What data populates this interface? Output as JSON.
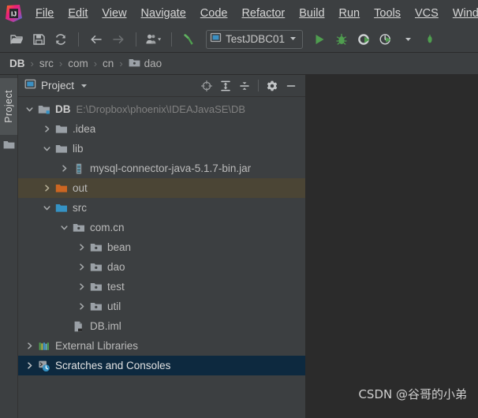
{
  "app": {
    "logo_icon": "intellij-idea-logo",
    "watermark": "CSDN @谷哥的小弟"
  },
  "menubar": {
    "items": [
      {
        "label": "File",
        "mnemonic": "F"
      },
      {
        "label": "Edit",
        "mnemonic": "E"
      },
      {
        "label": "View",
        "mnemonic": "V"
      },
      {
        "label": "Navigate",
        "mnemonic": "N"
      },
      {
        "label": "Code",
        "mnemonic": "C"
      },
      {
        "label": "Refactor",
        "mnemonic": "R"
      },
      {
        "label": "Build",
        "mnemonic": "B"
      },
      {
        "label": "Run",
        "mnemonic": "u"
      },
      {
        "label": "Tools",
        "mnemonic": "T"
      },
      {
        "label": "VCS",
        "mnemonic": "S"
      },
      {
        "label": "Window",
        "mnemonic": "W"
      }
    ]
  },
  "toolbar": {
    "buttons": [
      {
        "name": "open-project-icon",
        "title": "Open"
      },
      {
        "name": "save-all-icon",
        "title": "Save All"
      },
      {
        "name": "sync-refresh-icon",
        "title": "Synchronize"
      },
      {
        "name": "back-arrow-icon",
        "title": "Back"
      },
      {
        "name": "forward-arrow-icon",
        "title": "Forward"
      },
      {
        "name": "vcs-user-icon",
        "title": "User"
      },
      {
        "name": "build-hammer-icon",
        "title": "Build Project"
      }
    ],
    "run_config": {
      "label": "TestJDBC01",
      "icon": "run-config-icon",
      "dropdown_icon": "chevron-down-icon"
    },
    "run_buttons": [
      {
        "name": "run-icon",
        "title": "Run",
        "color": "#3f9c41"
      },
      {
        "name": "debug-icon",
        "title": "Debug",
        "color": "#3f9c41"
      },
      {
        "name": "coverage-icon",
        "title": "Run with Coverage",
        "color": "#3f9c41"
      },
      {
        "name": "profiler-icon",
        "title": "Profile",
        "color": "#3f9c41"
      }
    ]
  },
  "breadcrumb": {
    "separator": "›",
    "items": [
      {
        "label": "DB",
        "bold": true,
        "icon": null
      },
      {
        "label": "src",
        "bold": false,
        "icon": null
      },
      {
        "label": "com",
        "bold": false,
        "icon": null
      },
      {
        "label": "cn",
        "bold": false,
        "icon": null
      },
      {
        "label": "dao",
        "bold": false,
        "icon": "package-folder-icon"
      }
    ]
  },
  "left_strip": {
    "tab_label": "Project",
    "tab_icon": "project-folder-icon"
  },
  "project_panel": {
    "title": "Project",
    "title_icon": "project-view-icon",
    "dropdown_icon": "chevron-down-icon",
    "actions": [
      {
        "name": "locate-target-icon",
        "title": "Select Opened File"
      },
      {
        "name": "expand-all-icon",
        "title": "Expand All"
      },
      {
        "name": "collapse-all-icon",
        "title": "Collapse All"
      },
      {
        "name": "settings-gear-icon",
        "title": "Options"
      },
      {
        "name": "minimize-icon",
        "title": "Hide"
      }
    ]
  },
  "tree": {
    "rows": [
      {
        "label": "DB",
        "path": "E:\\Dropbox\\phoenix\\IDEAJavaSE\\DB",
        "indent": 0,
        "arrow": "down",
        "icon": "project-root-icon",
        "bold": true,
        "state": "normal"
      },
      {
        "label": ".idea",
        "path": "",
        "indent": 1,
        "arrow": "right",
        "icon": "folder-gray-icon",
        "bold": false,
        "state": "normal"
      },
      {
        "label": "lib",
        "path": "",
        "indent": 1,
        "arrow": "down",
        "icon": "folder-gray-icon",
        "bold": false,
        "state": "normal"
      },
      {
        "label": "mysql-connector-java-5.1.7-bin.jar",
        "path": "",
        "indent": 2,
        "arrow": "right",
        "icon": "jar-file-icon",
        "bold": false,
        "state": "normal"
      },
      {
        "label": "out",
        "path": "",
        "indent": 1,
        "arrow": "right",
        "icon": "folder-orange-icon",
        "bold": false,
        "state": "highlighted"
      },
      {
        "label": "src",
        "path": "",
        "indent": 1,
        "arrow": "down",
        "icon": "folder-blue-icon",
        "bold": false,
        "state": "normal"
      },
      {
        "label": "com.cn",
        "path": "",
        "indent": 2,
        "arrow": "down",
        "icon": "package-folder-icon",
        "bold": false,
        "state": "normal"
      },
      {
        "label": "bean",
        "path": "",
        "indent": 3,
        "arrow": "right",
        "icon": "package-folder-icon",
        "bold": false,
        "state": "normal"
      },
      {
        "label": "dao",
        "path": "",
        "indent": 3,
        "arrow": "right",
        "icon": "package-folder-icon",
        "bold": false,
        "state": "normal"
      },
      {
        "label": "test",
        "path": "",
        "indent": 3,
        "arrow": "right",
        "icon": "package-folder-icon",
        "bold": false,
        "state": "normal"
      },
      {
        "label": "util",
        "path": "",
        "indent": 3,
        "arrow": "right",
        "icon": "package-folder-icon",
        "bold": false,
        "state": "normal"
      },
      {
        "label": "DB.iml",
        "path": "",
        "indent": 2,
        "arrow": "none",
        "icon": "iml-file-icon",
        "bold": false,
        "state": "normal"
      },
      {
        "label": "External Libraries",
        "path": "",
        "indent": 0,
        "arrow": "right",
        "icon": "libraries-icon",
        "bold": false,
        "state": "normal"
      },
      {
        "label": "Scratches and Consoles",
        "path": "",
        "indent": 0,
        "arrow": "right",
        "icon": "scratches-icon",
        "bold": false,
        "state": "selected"
      }
    ]
  },
  "colors": {
    "panel_bg": "#3c3f41",
    "editor_bg": "#2b2b2b",
    "selection_bg": "#0d293f",
    "highlight_bg": "#4b4535",
    "accent_green": "#3f9c41",
    "folder_orange": "#cc6622",
    "folder_blue": "#3592c4",
    "folder_gray": "#9aa0a6",
    "text": "#bbbbbb"
  }
}
